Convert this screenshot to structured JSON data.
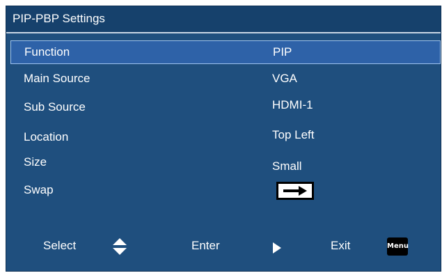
{
  "window": {
    "title": "PIP-PBP Settings"
  },
  "settings": [
    {
      "label": "Function",
      "value": "PIP",
      "selected": true
    },
    {
      "label": "Main Source",
      "value": "VGA"
    },
    {
      "label": "Sub Source",
      "value": "HDMI-1"
    },
    {
      "label": "Location",
      "value": "Top Left"
    },
    {
      "label": "Size",
      "value": "Small"
    },
    {
      "label": "Swap",
      "value_icon": "right-arrow-icon"
    }
  ],
  "footer": {
    "select_label": "Select",
    "select_icon": "up-down-triangles-icon",
    "enter_label": "Enter",
    "enter_icon": "play-triangle-icon",
    "exit_label": "Exit",
    "exit_badge": "Menu"
  },
  "colors": {
    "panel_bg": "#1f4f7e",
    "title_bg": "#16416c",
    "selected_bg": "#2e62a8",
    "text": "#ffffff"
  }
}
